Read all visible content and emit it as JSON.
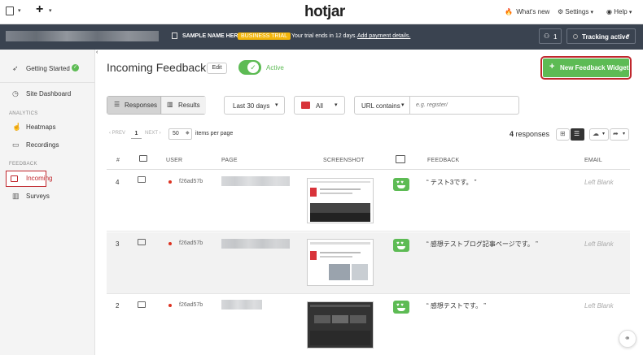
{
  "topbar": {
    "logo": "hotjar",
    "whats_new": "What's new",
    "settings": "Settings",
    "help": "Help"
  },
  "darkbar": {
    "site_name": "SAMPLE NAME HERE",
    "trial_badge": "BUSINESS TRIAL",
    "trial_text": "Your trial ends in 12 days.",
    "payment_link": "Add payment details.",
    "user_count": "1",
    "tracking": "Tracking active"
  },
  "sidebar": {
    "getting_started": "Getting Started",
    "site_dashboard": "Site Dashboard",
    "analytics_section": "ANALYTICS",
    "heatmaps": "Heatmaps",
    "recordings": "Recordings",
    "feedback_section": "FEEDBACK",
    "incoming": "Incoming",
    "surveys": "Surveys"
  },
  "header": {
    "title": "Incoming Feedback",
    "edit_label": "Edit",
    "toggle_label": "Active",
    "new_widget": "New Feedback Widget"
  },
  "filters": {
    "responses_tab": "Responses",
    "results_tab": "Results",
    "date_range": "Last 30 days",
    "emotion": "All",
    "url_filter": "URL contains",
    "url_placeholder": "e.g. register/"
  },
  "pagination": {
    "prev": "PREV",
    "page": "1",
    "next": "NEXT",
    "per_page": "50",
    "per_page_label": "items per page",
    "count": "4",
    "count_label": "responses"
  },
  "table": {
    "headers": {
      "num": "#",
      "user": "USER",
      "page": "PAGE",
      "screenshot": "SCREENSHOT",
      "feedback": "FEEDBACK",
      "email": "EMAIL"
    },
    "rows": [
      {
        "num": "4",
        "user": "f26ad57b",
        "feedback": "“ テスト3です。 ”",
        "email": "Left Blank"
      },
      {
        "num": "3",
        "user": "f26ad57b",
        "feedback": "“ 感想テストブログ記事ページです。 ”",
        "email": "Left Blank"
      },
      {
        "num": "2",
        "user": "f26ad57b",
        "feedback": "“ 感想テストです。 ”",
        "email": "Left Blank"
      }
    ]
  },
  "colors": {
    "green": "#5dbb54",
    "dark": "#3a4350",
    "red": "#c0272d",
    "trial": "#f2b50b"
  }
}
